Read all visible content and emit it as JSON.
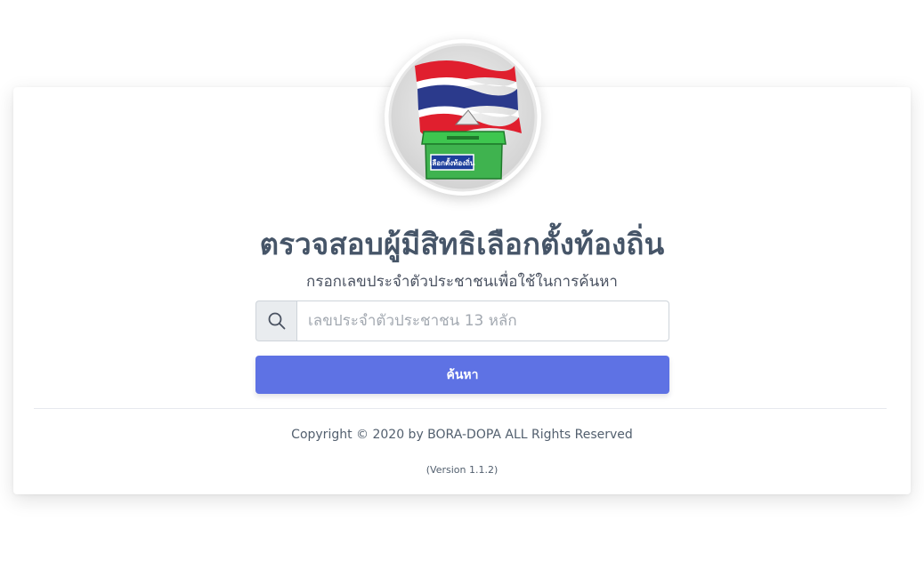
{
  "logo": {
    "icon": "thai-flag-ballot-box-icon",
    "box_label": "เลือกตั้งท้องถิ่น",
    "colors": {
      "flag_red": "#e01f2e",
      "flag_blue": "#2b3a8c",
      "box_green": "#3fb34f",
      "label_blue": "#1d3f9c"
    }
  },
  "header": {
    "title": "ตรวจสอบผู้มีสิทธิเลือกตั้งท้องถิ่น",
    "subtitle": "กรอกเลขประจำตัวประชาชนเพื่อใช้ในการค้นหา"
  },
  "search": {
    "icon": "search-icon",
    "value": "",
    "placeholder": "เลขประจำตัวประชาชน 13 หลัก",
    "button_label": "ค้นหา",
    "button_color": "#5e72e4"
  },
  "footer": {
    "copyright": "Copyright © 2020 by BORA-DOPA ALL Rights Reserved",
    "version": "(Version 1.1.2)"
  }
}
